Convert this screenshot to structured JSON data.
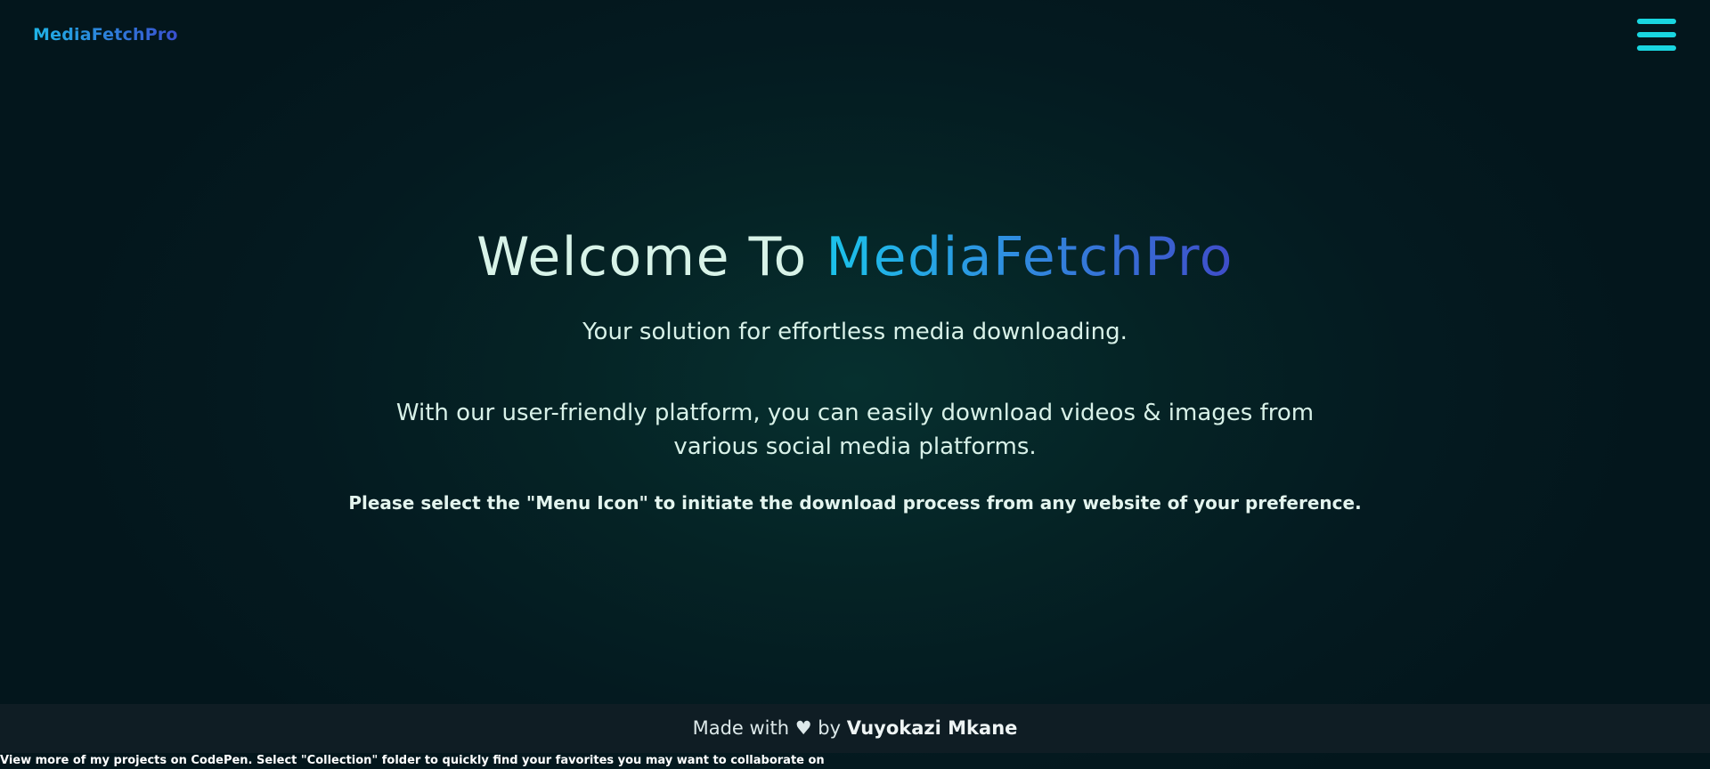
{
  "header": {
    "brand": "MediaFetchPro",
    "menu_icon": "hamburger-menu-icon",
    "menu_color": "#19d6e0"
  },
  "hero": {
    "headline_prefix": "Welcome To ",
    "headline_accent": "MediaFetchPro",
    "tagline": "Your solution for effortless media downloading.",
    "description": "With our user-friendly platform, you can easily download videos & images from various social media platforms.",
    "instruction": "Please select the \"Menu Icon\" to initiate the download process from any website of your preference."
  },
  "footer": {
    "made_with": "Made with",
    "heart": "♥",
    "by": "by",
    "author": "Vuyokazi Mkane"
  },
  "codepen_note": "View more of my projects on CodePen. Select \"Collection\" folder to quickly find your favorites you may want to collaborate on",
  "colors": {
    "background": "#041a20",
    "accent_start": "#1bc3ea",
    "accent_end": "#3f4cc9",
    "text": "#d8f1e8",
    "footer_bg": "#0f1d24"
  }
}
